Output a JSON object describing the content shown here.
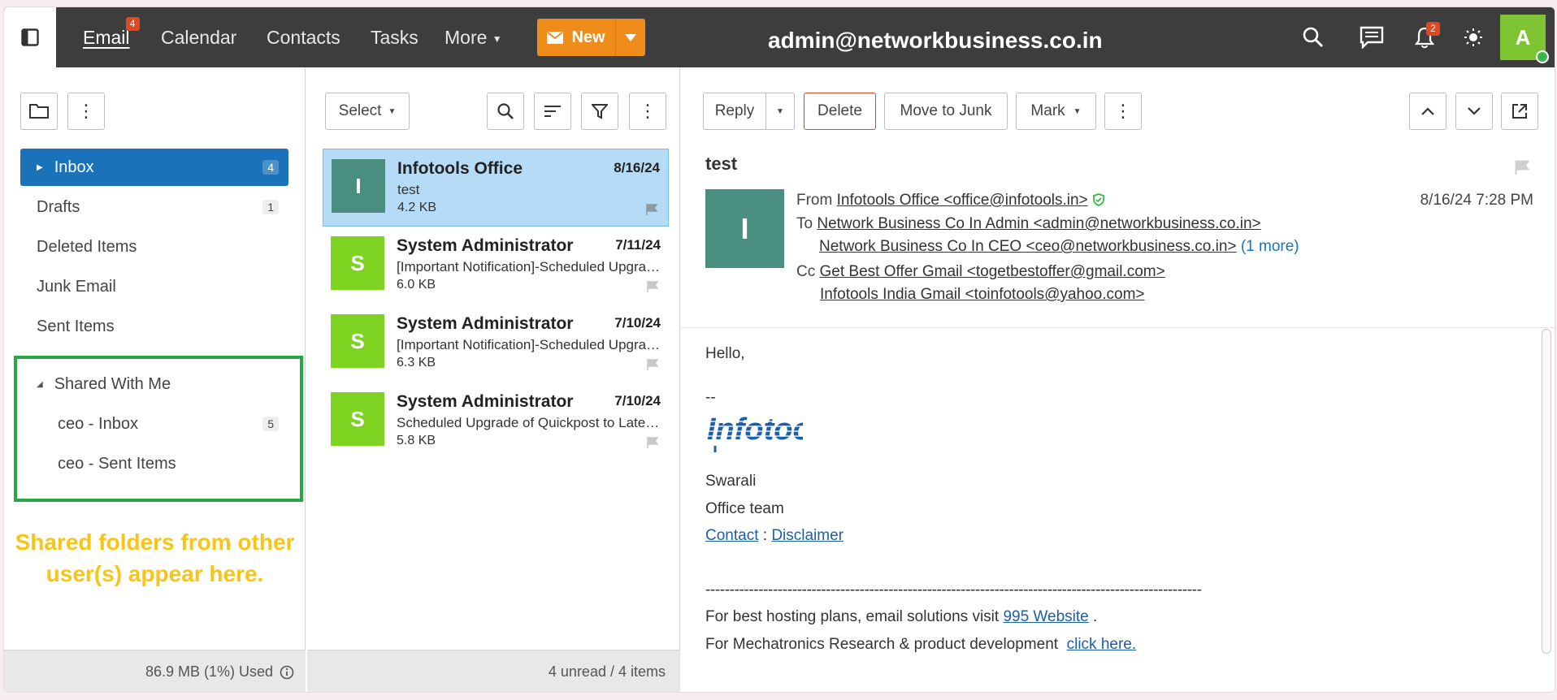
{
  "topbar": {
    "nav": [
      {
        "label": "Email",
        "badge": "4"
      },
      {
        "label": "Calendar"
      },
      {
        "label": "Contacts"
      },
      {
        "label": "Tasks"
      },
      {
        "label": "More"
      }
    ],
    "new_label": "New",
    "account": "admin@networkbusiness.co.in",
    "notifications_badge": "2",
    "avatar_initial": "A",
    "icons": [
      "sidebar-toggle-icon",
      "search-icon",
      "chat-icon",
      "bell-icon",
      "theme-sun-icon"
    ]
  },
  "folders": {
    "items": [
      {
        "label": "Inbox",
        "count": "4",
        "selected": true
      },
      {
        "label": "Drafts",
        "count": "1"
      },
      {
        "label": "Deleted Items"
      },
      {
        "label": "Junk Email"
      },
      {
        "label": "Sent Items"
      }
    ],
    "shared": {
      "label": "Shared With Me",
      "items": [
        {
          "label": "ceo - Inbox",
          "count": "5"
        },
        {
          "label": "ceo - Sent Items"
        }
      ]
    },
    "annotation_line1": "Shared folders from other",
    "annotation_line2": "user(s) appear here.",
    "quota": "86.9 MB (1%) Used",
    "highlight_color": "#27a844",
    "annotation_color": "#f5c518"
  },
  "list": {
    "select_label": "Select",
    "messages": [
      {
        "initial": "I",
        "from": "Infotools Office",
        "date": "8/16/24",
        "subject": "test",
        "size": "4.2 KB",
        "color": "#4a8e80",
        "selected": true
      },
      {
        "initial": "S",
        "from": "System Administrator",
        "date": "7/11/24",
        "subject": "[Important Notification]-Scheduled Upgrade of Quickpost",
        "size": "6.0 KB",
        "color": "#7ed321"
      },
      {
        "initial": "S",
        "from": "System Administrator",
        "date": "7/10/24",
        "subject": "[Important Notification]-Scheduled Upgrade of Quickpost",
        "size": "6.3 KB",
        "color": "#7ed321"
      },
      {
        "initial": "S",
        "from": "System Administrator",
        "date": "7/10/24",
        "subject": "Scheduled Upgrade of Quickpost to Latest Version",
        "size": "5.8 KB",
        "color": "#7ed321"
      }
    ],
    "footer": "4 unread / 4 items"
  },
  "reader": {
    "toolbar": {
      "reply": "Reply",
      "delete": "Delete",
      "junk": "Move to Junk",
      "mark": "Mark"
    },
    "subject": "test",
    "avatar_initial": "I",
    "from_label": "From",
    "from": "Infotools Office <office@infotools.in>",
    "to_label": "To",
    "to1": "Network Business Co In Admin <admin@networkbusiness.co.in>",
    "to2": "Network Business Co In CEO <ceo@networkbusiness.co.in>",
    "to_more": "(1 more)",
    "cc_label": "Cc",
    "cc1": "Get Best Offer Gmail <togetbestoffer@gmail.com>",
    "cc2": "Infotools India Gmail <toinfotools@yahoo.com>",
    "date": "8/16/24 7:28 PM",
    "body": {
      "greeting": "Hello,",
      "sig_sep": "--",
      "logo_text": "Infotools",
      "name": "Swarali",
      "team": "Office team",
      "contact": "Contact",
      "colon": " : ",
      "disclaimer": "Disclaimer",
      "rule": "-------------------------------------------------------------------------------------------------------",
      "hosting_text": "For best hosting plans, email solutions visit ",
      "hosting_link": "995 Website",
      "hosting_end": " .",
      "mech_text": "For Mechatronics Research & product development  ",
      "mech_link": "click here."
    }
  }
}
